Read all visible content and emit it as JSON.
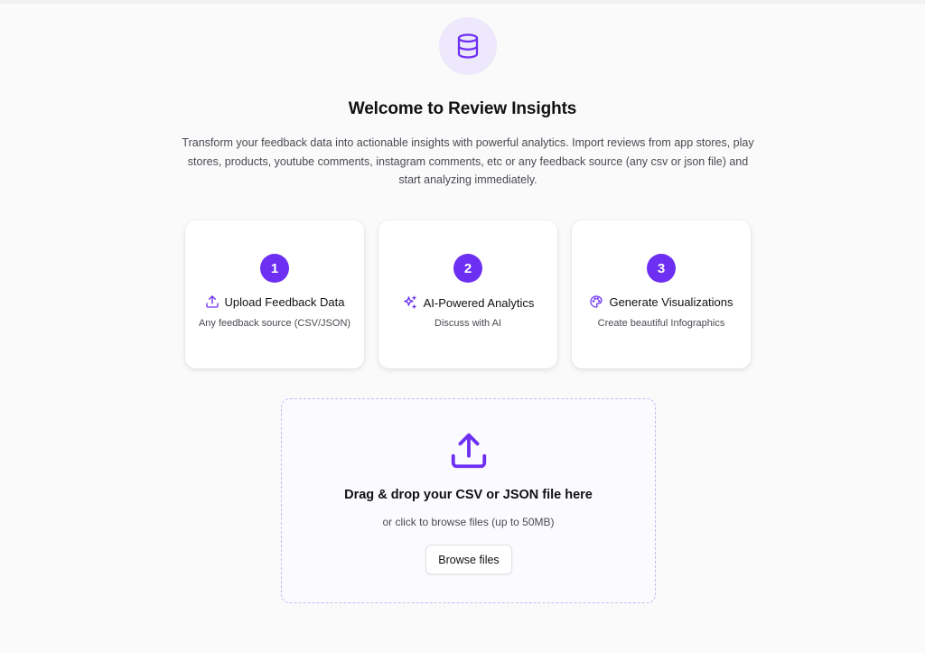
{
  "header": {
    "title": "Welcome to Review Insights",
    "description": "Transform your feedback data into actionable insights with powerful analytics. Import reviews from app stores, play stores, products, youtube comments, instagram comments, etc or any feedback source (any csv or json file) and start analyzing immediately.",
    "icon": "database-icon"
  },
  "steps": [
    {
      "number": "1",
      "icon": "upload-icon",
      "title": "Upload Feedback Data",
      "subtitle": "Any feedback source (CSV/JSON)"
    },
    {
      "number": "2",
      "icon": "sparkles-icon",
      "title": "AI-Powered Analytics",
      "subtitle": "Discuss with AI"
    },
    {
      "number": "3",
      "icon": "palette-icon",
      "title": "Generate Visualizations",
      "subtitle": "Create beautiful Infographics"
    }
  ],
  "dropzone": {
    "icon": "upload-icon",
    "title": "Drag & drop your CSV or JSON file here",
    "subtitle": "or click to browse files (up to 50MB)",
    "button_label": "Browse files"
  },
  "colors": {
    "accent": "#6d2ff2",
    "accent_light": "#ede8fb",
    "dropzone_border": "#c8b9f3"
  }
}
